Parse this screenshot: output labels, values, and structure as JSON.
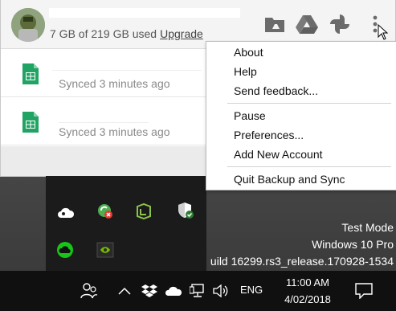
{
  "panel": {
    "storage_text": "7 GB of 219 GB used",
    "upgrade_label": "Upgrade",
    "header_icons": [
      "drive-folder-icon",
      "google-drive-icon",
      "google-photos-icon",
      "more-vert-icon"
    ],
    "files": [
      {
        "status": "Synced 3 minutes ago",
        "icon": "google-sheets-icon"
      },
      {
        "status": "Synced 3 minutes ago",
        "icon": "google-sheets-icon"
      }
    ]
  },
  "menu": {
    "items": [
      "About",
      "Help",
      "Send feedback...",
      "Pause",
      "Preferences...",
      "Add New Account",
      "Quit Backup and Sync"
    ]
  },
  "watermark": {
    "line1": "Test Mode",
    "line2": "Windows 10 Pro",
    "line3": "uild 16299.rs3_release.170928-1534"
  },
  "taskbar": {
    "language": "ENG",
    "time": "11:00 AM",
    "date": "4/02/2018"
  },
  "colors": {
    "sheets_green": "#1fa463",
    "taskbar_bg": "#101010",
    "tray_flyout_bg": "#1b1b1b"
  }
}
